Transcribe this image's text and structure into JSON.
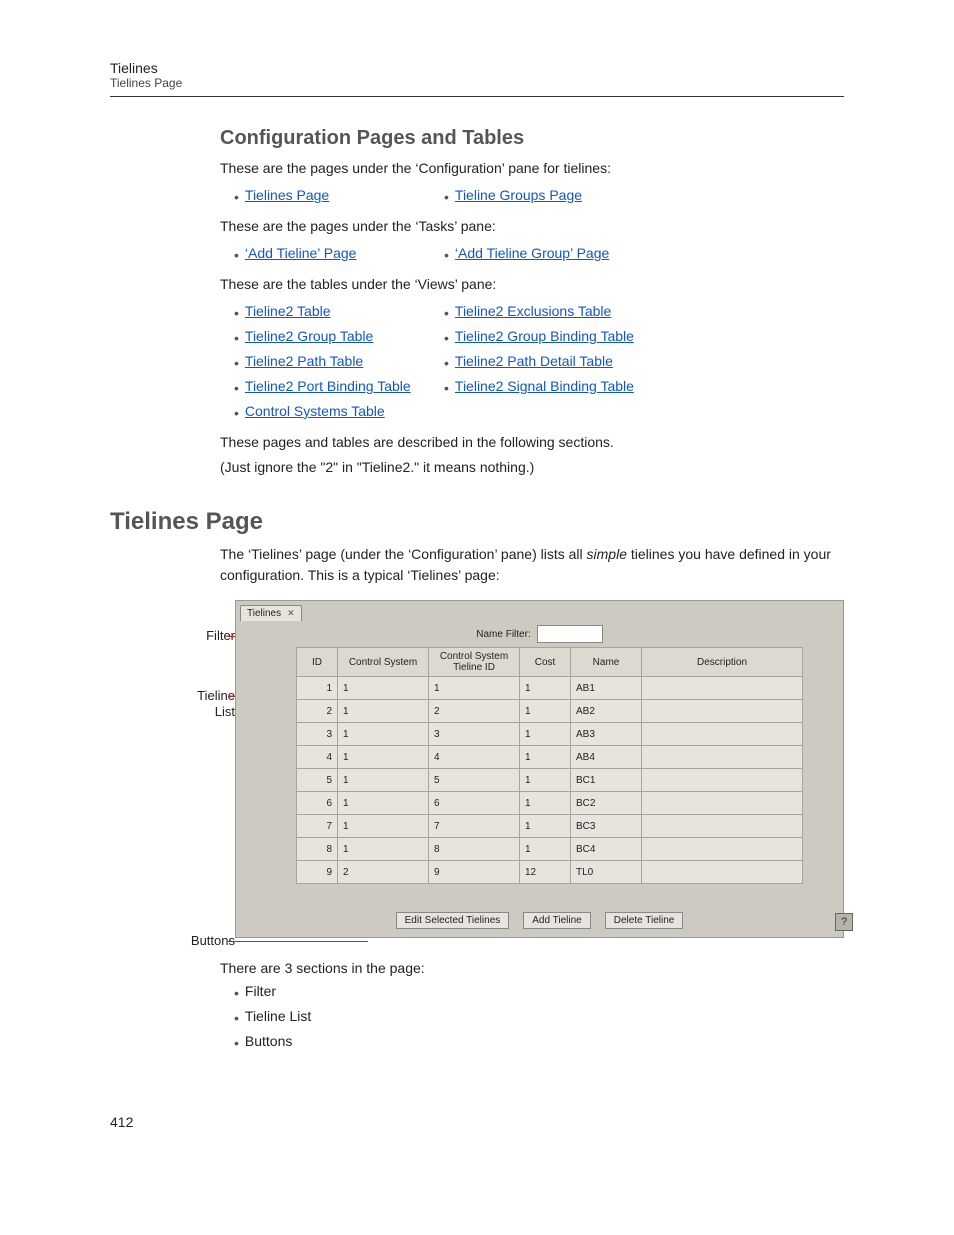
{
  "header": {
    "title": "Tielines",
    "subtitle": "Tielines Page"
  },
  "h2": "Configuration Pages and Tables",
  "p1": "These are the pages under the ‘Configuration’ pane for tielines:",
  "cfg_links": {
    "col1": [
      {
        "label": "Tielines Page"
      }
    ],
    "col2": [
      {
        "label": "Tieline Groups Page"
      }
    ]
  },
  "p2": "These are the pages under the ‘Tasks’ pane:",
  "task_links": {
    "col1": [
      {
        "label": "‘Add Tieline’ Page"
      }
    ],
    "col2": [
      {
        "label": "‘Add Tieline Group’ Page"
      }
    ]
  },
  "p3": "These are the tables under the ‘Views’ pane:",
  "view_links": {
    "col1": [
      {
        "label": "Tieline2 Table"
      },
      {
        "label": "Tieline2 Group Table"
      },
      {
        "label": "Tieline2 Path Table"
      },
      {
        "label": "Tieline2 Port Binding Table"
      },
      {
        "label": "Control Systems Table"
      }
    ],
    "col2": [
      {
        "label": "Tieline2 Exclusions Table"
      },
      {
        "label": "Tieline2 Group Binding Table"
      },
      {
        "label": "Tieline2 Path Detail Table"
      },
      {
        "label": "Tieline2 Signal Binding Table"
      }
    ]
  },
  "p4": "These pages and tables are described in the following sections.",
  "p5": "(Just ignore the \"2\" in \"Tieline2.\" it means nothing.)",
  "h1": "Tielines Page",
  "p6a": "The ‘Tielines’ page (under the ‘Configuration’ pane) lists all ",
  "p6i": "simple",
  "p6b": " tielines you have defined in your configuration. This is a typical ‘Tielines’ page:",
  "ann": {
    "filter": "Filter",
    "list1": "Tieline",
    "list2": "List",
    "buttons": "Buttons"
  },
  "shot": {
    "tab": "Tielines",
    "filter_label": "Name Filter:",
    "filter_value": "",
    "headers": [
      "ID",
      "Control System",
      "Control System Tieline ID",
      "Cost",
      "Name",
      "Description"
    ],
    "rows": [
      {
        "id": "1",
        "cs": "1",
        "cstid": "1",
        "cost": "1",
        "name": "AB1",
        "desc": ""
      },
      {
        "id": "2",
        "cs": "1",
        "cstid": "2",
        "cost": "1",
        "name": "AB2",
        "desc": ""
      },
      {
        "id": "3",
        "cs": "1",
        "cstid": "3",
        "cost": "1",
        "name": "AB3",
        "desc": ""
      },
      {
        "id": "4",
        "cs": "1",
        "cstid": "4",
        "cost": "1",
        "name": "AB4",
        "desc": ""
      },
      {
        "id": "5",
        "cs": "1",
        "cstid": "5",
        "cost": "1",
        "name": "BC1",
        "desc": ""
      },
      {
        "id": "6",
        "cs": "1",
        "cstid": "6",
        "cost": "1",
        "name": "BC2",
        "desc": ""
      },
      {
        "id": "7",
        "cs": "1",
        "cstid": "7",
        "cost": "1",
        "name": "BC3",
        "desc": ""
      },
      {
        "id": "8",
        "cs": "1",
        "cstid": "8",
        "cost": "1",
        "name": "BC4",
        "desc": ""
      },
      {
        "id": "9",
        "cs": "2",
        "cstid": "9",
        "cost": "12",
        "name": "TL0",
        "desc": ""
      }
    ],
    "btn1": "Edit Selected Tielines",
    "btn2": "Add Tieline",
    "btn3": "Delete Tieline",
    "help": "?"
  },
  "p7": "There are 3 sections in the page:",
  "sections": [
    {
      "label": "Filter"
    },
    {
      "label": "Tieline List"
    },
    {
      "label": "Buttons"
    }
  ],
  "pagenum": "412"
}
